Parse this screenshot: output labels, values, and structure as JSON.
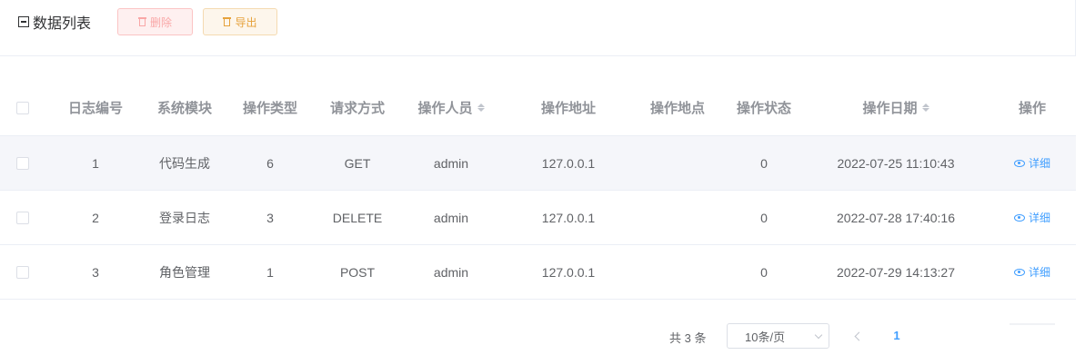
{
  "toolbar": {
    "title": "数据列表",
    "delete_label": "删除",
    "export_label": "导出"
  },
  "table": {
    "headers": {
      "id": "日志编号",
      "module": "系统模块",
      "type": "操作类型",
      "method": "请求方式",
      "operator": "操作人员",
      "address": "操作地址",
      "location": "操作地点",
      "status": "操作状态",
      "date": "操作日期",
      "action": "操作"
    },
    "rows": [
      {
        "id": "1",
        "module": "代码生成",
        "type": "6",
        "method": "GET",
        "operator": "admin",
        "address": "127.0.0.1",
        "location": "",
        "status": "0",
        "date": "2022-07-25 11:10:43",
        "action": "详细"
      },
      {
        "id": "2",
        "module": "登录日志",
        "type": "3",
        "method": "DELETE",
        "operator": "admin",
        "address": "127.0.0.1",
        "location": "",
        "status": "0",
        "date": "2022-07-28 17:40:16",
        "action": "详细"
      },
      {
        "id": "3",
        "module": "角色管理",
        "type": "1",
        "method": "POST",
        "operator": "admin",
        "address": "127.0.0.1",
        "location": "",
        "status": "0",
        "date": "2022-07-29 14:13:27",
        "action": "详细"
      }
    ]
  },
  "pagination": {
    "total": "共 3 条",
    "page_size": "10条/页",
    "current_page": "1"
  },
  "colors": {
    "primary": "#409eff",
    "danger_light": "#fef0f0",
    "warning": "#e6a23c"
  }
}
